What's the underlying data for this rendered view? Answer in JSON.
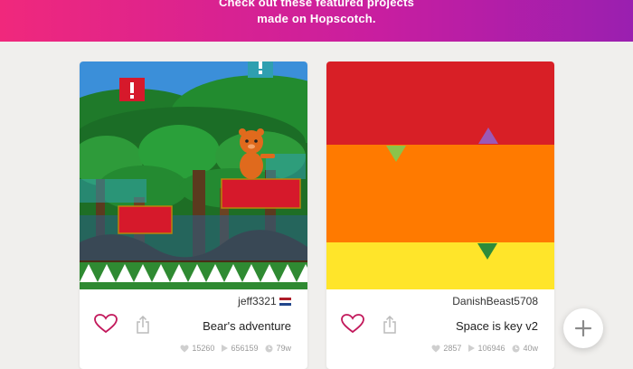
{
  "banner": {
    "line1": "Check out these featured projects",
    "line2": "made on Hopscotch."
  },
  "projects": [
    {
      "author": "jeff3321",
      "author_flag": "netherlands-flag-icon",
      "title": "Bear's adventure",
      "likes": "15260",
      "plays": "656159",
      "age": "79w"
    },
    {
      "author": "DanishBeast5708",
      "title": "Space is key v2",
      "likes": "2857",
      "plays": "106946",
      "age": "40w"
    }
  ],
  "colors": {
    "banner_start": "#f0287c",
    "banner_end": "#9a1fb0",
    "heart": "#c2185b",
    "space_red": "#d81f26",
    "space_orange": "#ff7a00",
    "space_yellow": "#ffe52a"
  },
  "fab": {
    "icon": "plus-icon"
  }
}
